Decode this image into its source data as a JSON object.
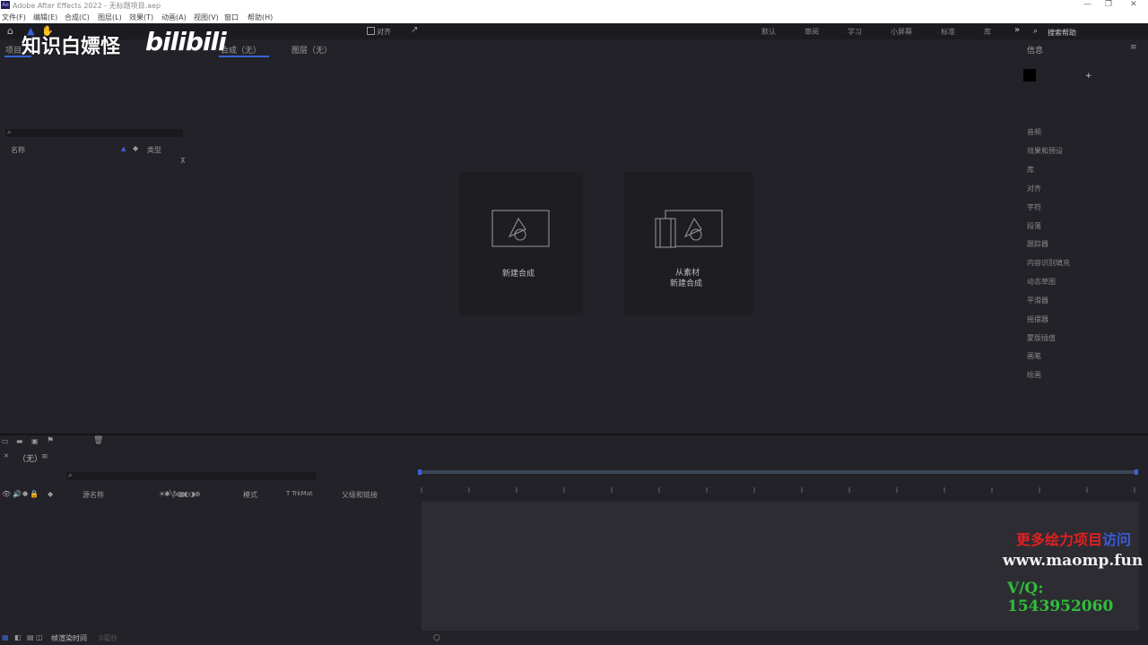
{
  "titlebar": {
    "title": "Adobe After Effects 2022 - 无标题项目.aep",
    "min": "—",
    "restore": "❐",
    "close": "✕"
  },
  "menu": [
    "文件(F)",
    "编辑(E)",
    "合成(C)",
    "图层(L)",
    "效果(T)",
    "动画(A)",
    "视图(V)",
    "窗口",
    "帮助(H)"
  ],
  "toolbar": {
    "align_label": "对齐",
    "workspaces": [
      "默认",
      "审阅",
      "学习",
      "小屏幕",
      "标准",
      "库"
    ],
    "search_placeholder": "搜索帮助"
  },
  "project_panel": {
    "tab_project": "项目",
    "tab_composition": "合成（无）",
    "tab_layer": "图层（无）",
    "col_name": "名称",
    "col_type": "类型"
  },
  "center": {
    "new_comp_label": "新建合成",
    "from_footage_label_line1": "从素材",
    "from_footage_label_line2": "新建合成"
  },
  "right_panel": {
    "info_title": "信息",
    "items": [
      "音频",
      "效果和预设",
      "库",
      "对齐",
      "字符",
      "段落",
      "跟踪器",
      "内容识别填充",
      "动态草图",
      "平滑器",
      "摇摆器",
      "蒙版插值",
      "画笔",
      "绘画"
    ]
  },
  "timeline": {
    "comp_none": "（无）",
    "col_source": "源名称",
    "col_mode": "模式",
    "col_trkmat": "T  TrkMat",
    "col_parent": "父级和链接",
    "render_time": "帧渲染时间",
    "render_time_value": "0毫秒"
  },
  "watermark": {
    "text": "知识白嫖怪",
    "logo": "bilibili",
    "promo_red": "更多绘力项目",
    "promo_blue": "访问",
    "promo_url": "www.maomp.fun",
    "promo_qq": "V/Q:  1543952060"
  },
  "colors": {
    "bg": "#232228",
    "accent": "#3a64d8",
    "panel_dark": "#1c1b20"
  }
}
